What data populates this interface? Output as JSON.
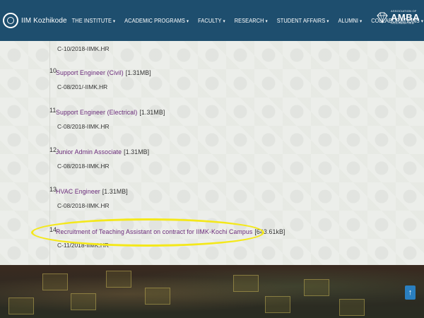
{
  "header": {
    "logo_text": "IIM Kozhikode",
    "nav": [
      {
        "label": "THE INSTITUTE",
        "caret": "▾"
      },
      {
        "label": "ACADEMIC PROGRAMS",
        "caret": "▾"
      },
      {
        "label": "FACULTY",
        "caret": "▾"
      },
      {
        "label": "RESEARCH",
        "caret": "▾"
      },
      {
        "label": "STUDENT AFFAIRS",
        "caret": "▾"
      },
      {
        "label": "ALUMNI",
        "caret": "▾"
      },
      {
        "label": "COLLABORATIONS",
        "caret": "▾"
      }
    ],
    "accreditation": {
      "small": "ASSOCIATION OF",
      "big": "AMBA",
      "accredited": "ACCREDITED"
    }
  },
  "listings": {
    "top_code": "C-10/2018-IIMK.HR",
    "items": [
      {
        "num": "10.",
        "title": "Support Engineer (Civil)",
        "size": "[1.31MB]",
        "code": "C-08/201/-IIMK.HR"
      },
      {
        "num": "11.",
        "title": "Support Engineer (Electrical)",
        "size": "[1.31MB]",
        "code": "C-08/2018-IIMK.HR"
      },
      {
        "num": "12.",
        "title": "Junior Admin Associate",
        "size": "[1.31MB]",
        "code": "C-08/2018-IIMK.HR"
      },
      {
        "num": "13.",
        "title": "HVAC Engineer",
        "size": "[1.31MB]",
        "code": "C-08/2018-IIMK.HR"
      },
      {
        "num": "14.",
        "title": "Recruitment of Teaching Assistant on contract for IIMK-Kochi Campus",
        "size": "[643.61kB]",
        "code": "C-11/2018-IIMK.HR"
      }
    ]
  },
  "scroll_top_label": "↑",
  "colors": {
    "header_bg": "#1e4e6e",
    "link": "#6a2a7a",
    "highlight": "#f4e81a",
    "scroll_button": "#2a7fc0"
  }
}
